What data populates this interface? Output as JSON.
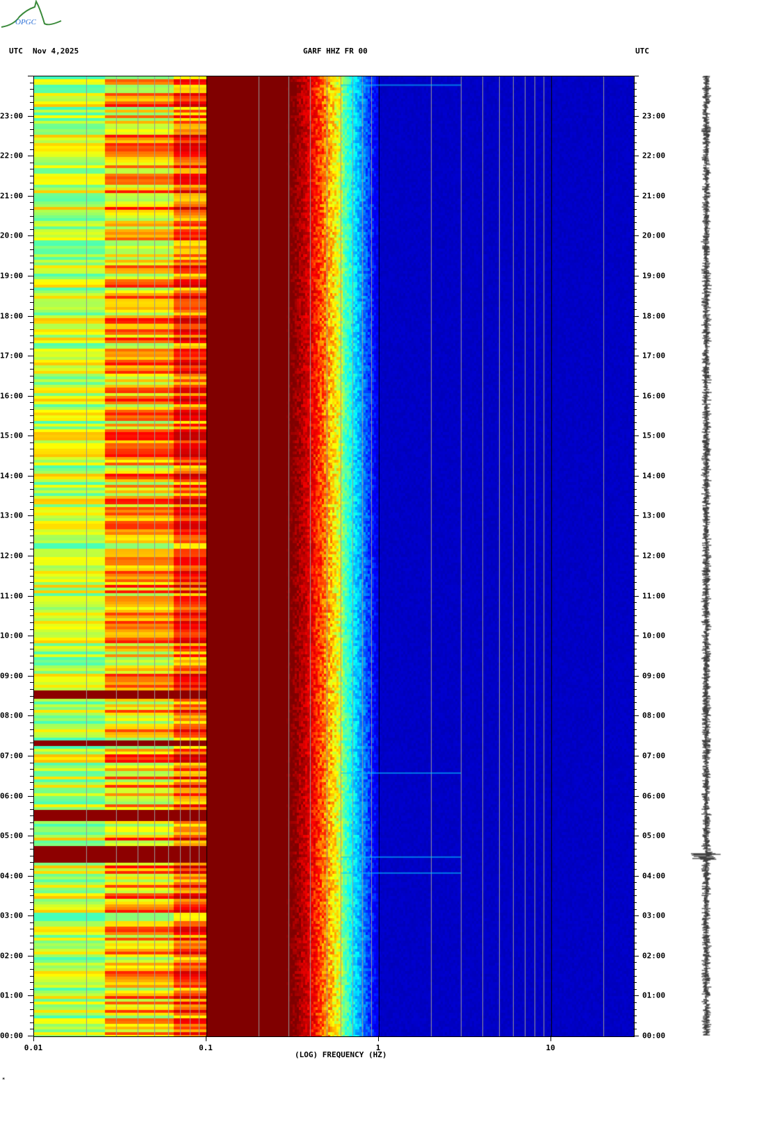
{
  "logo": {
    "text": "OPGC"
  },
  "header": {
    "left_tz": "UTC",
    "date": "Nov 4,2025",
    "station": "GARF HHZ FR 00",
    "right_tz": "UTC"
  },
  "chart_data": {
    "type": "heatmap",
    "title": "GARF HHZ FR 00",
    "xlabel": "(LOG) FREQUENCY (HZ)",
    "ylabel": "UTC",
    "x_scale": "log",
    "xlim": [
      0.01,
      30
    ],
    "ylim_hours": [
      0,
      24
    ],
    "x_ticks": [
      {
        "v": 0.01,
        "label": "0.01"
      },
      {
        "v": 0.1,
        "label": "0.1"
      },
      {
        "v": 1,
        "label": "1"
      },
      {
        "v": 10,
        "label": "10"
      }
    ],
    "y_ticks": [
      "00:00",
      "01:00",
      "02:00",
      "03:00",
      "04:00",
      "05:00",
      "06:00",
      "07:00",
      "08:00",
      "09:00",
      "10:00",
      "11:00",
      "12:00",
      "13:00",
      "14:00",
      "15:00",
      "16:00",
      "17:00",
      "18:00",
      "19:00",
      "20:00",
      "21:00",
      "22:00",
      "23:00"
    ],
    "colormap": [
      "#00008b",
      "#0000ff",
      "#00ffff",
      "#ffff00",
      "#ff0000",
      "#800000"
    ],
    "events_hours": [
      4.5,
      4.1,
      6.6,
      23.8
    ],
    "description_bands": [
      {
        "fmin": 0.01,
        "fmax": 0.1,
        "level": "cyan-yellow"
      },
      {
        "fmin": 0.1,
        "fmax": 0.28,
        "level": "dark red (microseism peak)"
      },
      {
        "fmin": 0.28,
        "fmax": 0.6,
        "level": "red to cyan transition"
      },
      {
        "fmin": 0.6,
        "fmax": 30,
        "level": "dark blue"
      }
    ]
  },
  "footer": {
    "mark": "*"
  }
}
